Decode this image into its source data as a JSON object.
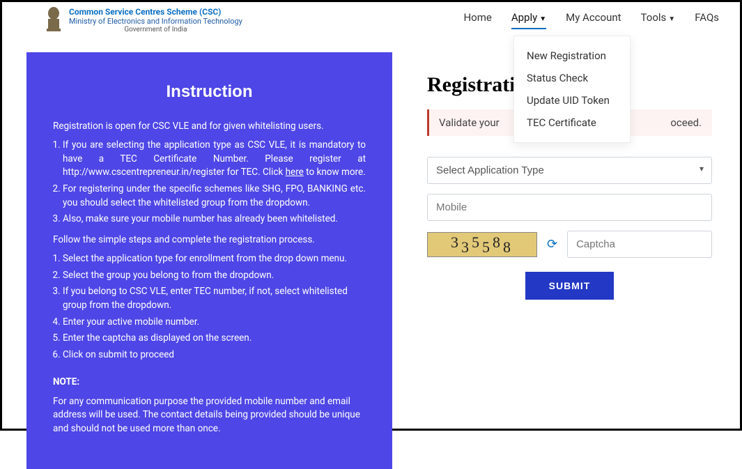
{
  "brand": {
    "title": "Common Service Centres Scheme (CSC)",
    "sub": "Ministry of Electronics and Information Technology",
    "sub2": "Government of India"
  },
  "nav": {
    "home": "Home",
    "apply": "Apply",
    "account": "My Account",
    "tools": "Tools",
    "faqs": "FAQs"
  },
  "dropdown": {
    "new_reg": "New Registration",
    "status": "Status Check",
    "uid": "Update UID Token",
    "tec": "TEC Certificate"
  },
  "left": {
    "heading": "Instruction",
    "intro": "Registration is open for CSC VLE and for given whitelisting users.",
    "list1": {
      "a": "If you are selecting the application type as CSC VLE, it is mandatory to have a TEC Certificate Number. Please register at http://www.cscentrepreneur.in/register for TEC. Click ",
      "here": "here",
      "a2": " to know more.",
      "b": "For registering under the specific schemes like SHG, FPO, BANKING etc. you should select the whitelisted group from the dropdown.",
      "c": "Also, make sure your mobile number has already been whitelisted."
    },
    "mid": "Follow the simple steps and complete the registration process.",
    "list2": {
      "a": "Select the application type for enrollment from the drop down menu.",
      "b": "Select the group you belong to from the dropdown.",
      "c": "If you belong to CSC VLE, enter TEC number, if not, select whitelisted group from the dropdown.",
      "d": "Enter your active mobile number.",
      "e": "Enter the captcha as displayed on the screen.",
      "f": "Click on submit to proceed"
    },
    "note_head": "NOTE:",
    "note": "For any communication purpose the provided mobile number and email address will be used. The contact details being provided should be unique and should not be used more than once."
  },
  "right": {
    "heading_visible": "Registrati",
    "alert_left": "Validate your ",
    "alert_right": "oceed.",
    "select_label": "Select Application Type",
    "mobile_ph": "Mobile",
    "captcha_value": "335588",
    "captcha_ph": "Captcha",
    "submit": "SUBMIT"
  }
}
